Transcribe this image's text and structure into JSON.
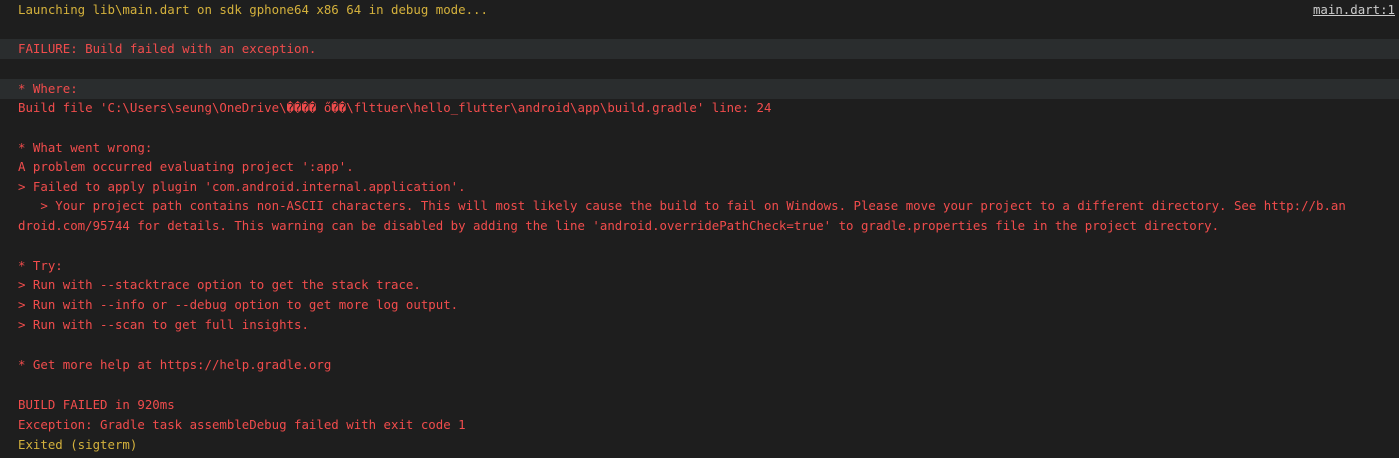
{
  "header": {
    "launch_message": "Launching lib\\main.dart on sdk gphone64 x86 64 in debug mode...",
    "source_link": "main.dart:1"
  },
  "output": {
    "failure": "FAILURE: Build failed with an exception.",
    "where_heading": "* Where:",
    "where_detail": "Build file 'C:\\Users\\seung\\OneDrive\\���� ő��\\flttuer\\hello_flutter\\android\\app\\build.gradle' line: 24",
    "wrong_heading": "* What went wrong:",
    "wrong_1": "A problem occurred evaluating project ':app'.",
    "wrong_2": "> Failed to apply plugin 'com.android.internal.application'.",
    "wrong_3": "   > Your project path contains non-ASCII characters. This will most likely cause the build to fail on Windows. Please move your project to a different directory. See http://b.an",
    "wrong_4": "droid.com/95744 for details. This warning can be disabled by adding the line 'android.overridePathCheck=true' to gradle.properties file in the project directory.",
    "try_heading": "* Try:",
    "try_1": "> Run with --stacktrace option to get the stack trace.",
    "try_2": "> Run with --info or --debug option to get more log output.",
    "try_3": "> Run with --scan to get full insights.",
    "help": "* Get more help at https://help.gradle.org",
    "build_failed": "BUILD FAILED in 920ms",
    "exception": "Exception: Gradle task assembleDebug failed with exit code 1",
    "exited": "Exited (sigterm)"
  },
  "colors": {
    "background": "#1e1e1e",
    "highlight_row": "#2a2d2e",
    "info_text": "#d4b13c",
    "error_text": "#f14c4c",
    "link_text": "#cccccc"
  }
}
